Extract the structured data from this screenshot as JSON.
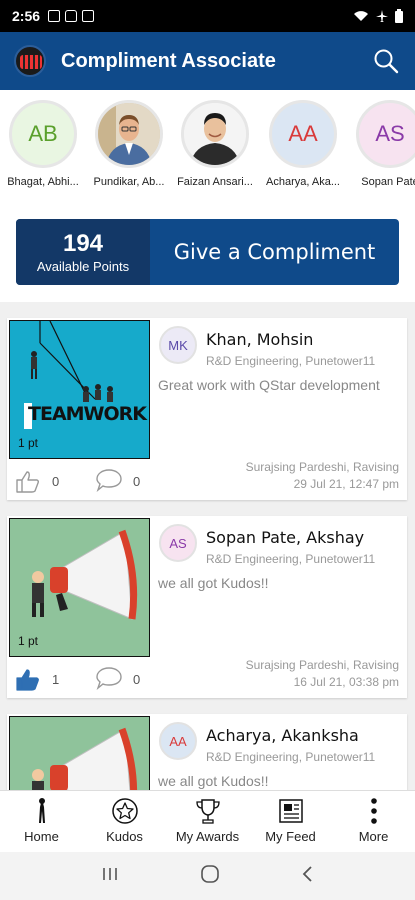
{
  "status_bar": {
    "time": "2:56"
  },
  "header": {
    "title": "Compliment Associate"
  },
  "associates": [
    {
      "initials": "AB",
      "name": "Bhagat, Abhi...",
      "color": "#5aa02c",
      "bg": "#e9f6e2",
      "photo": false
    },
    {
      "initials": "",
      "name": "Pundikar, Ab...",
      "color": "",
      "bg": "",
      "photo": true
    },
    {
      "initials": "",
      "name": "Faizan Ansari...",
      "color": "",
      "bg": "",
      "photo": true
    },
    {
      "initials": "AA",
      "name": "Acharya, Aka...",
      "color": "#d93a3a",
      "bg": "#dbe6f3",
      "photo": false
    },
    {
      "initials": "AS",
      "name": "Sopan Pate",
      "color": "#8a3aa8",
      "bg": "#f7e3f0",
      "photo": false
    }
  ],
  "points": {
    "value": "194",
    "label": "Available Points"
  },
  "give_compliment": {
    "label": "Give a Compliment"
  },
  "feed": [
    {
      "initials": "MK",
      "initials_color": "#5a4aa8",
      "initials_bg": "#eceaf6",
      "name": "Khan, Mohsin",
      "dept": "R&D Engineering, Punetower11",
      "message": "Great work with QStar development",
      "points": "1 pt",
      "from": "Surajsing Pardeshi, Ravising",
      "date": "29 Jul 21, 12:47 pm",
      "likes": "0",
      "comments": "0",
      "liked": false,
      "thumb_text": "TEAMWORK"
    },
    {
      "initials": "AS",
      "initials_color": "#8a3aa8",
      "initials_bg": "#f7e3f0",
      "name": "Sopan Pate, Akshay",
      "dept": "R&D Engineering, Punetower11",
      "message": "we all got Kudos!!",
      "points": "1 pt",
      "from": "Surajsing Pardeshi, Ravising",
      "date": "16 Jul 21, 03:38 pm",
      "likes": "1",
      "comments": "0",
      "liked": true
    },
    {
      "initials": "AA",
      "initials_color": "#d93a3a",
      "initials_bg": "#dbe6f3",
      "name": "Acharya, Akanksha",
      "dept": "R&D Engineering, Punetower11",
      "message": "we all got Kudos!!"
    }
  ],
  "nav": [
    {
      "label": "Home",
      "icon": "home-icon"
    },
    {
      "label": "Kudos",
      "icon": "kudos-icon"
    },
    {
      "label": "My Awards",
      "icon": "awards-icon"
    },
    {
      "label": "My Feed",
      "icon": "feed-icon"
    },
    {
      "label": "More",
      "icon": "more-icon"
    }
  ],
  "colors": {
    "primary": "#0f4a8a",
    "points_bg": "#133867",
    "like_active": "#2f6fb3"
  }
}
